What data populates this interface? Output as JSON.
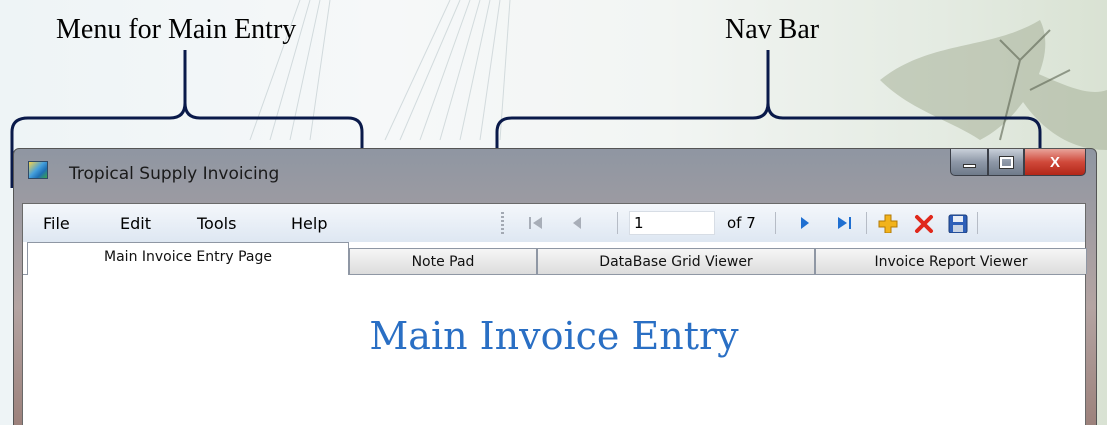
{
  "annotations": {
    "menu_label": "Menu for Main Entry",
    "nav_label": "Nav Bar"
  },
  "window": {
    "title": "Tropical Supply Invoicing",
    "caption_buttons": [
      "minimize-icon",
      "maximize-icon",
      "close-icon"
    ],
    "close_glyph": "X"
  },
  "menu": {
    "items": [
      "File",
      "Edit",
      "Tools",
      "Help"
    ]
  },
  "navbar": {
    "position": "1",
    "count": "of 7",
    "buttons": [
      "move-first-icon",
      "move-previous-icon",
      "move-next-icon",
      "move-last-icon",
      "add-new-icon",
      "delete-icon",
      "save-icon"
    ]
  },
  "tabs": {
    "items": [
      "Main Invoice Entry Page",
      "Note Pad",
      "DataBase Grid Viewer",
      "Invoice Report Viewer"
    ],
    "active_index": 0
  },
  "page": {
    "heading": "Main Invoice Entry"
  },
  "colors": {
    "heading": "#2a6fc4",
    "nav_arrow_active": "#1f6fd1",
    "nav_arrow_disabled": "#a8aeb8",
    "add_icon": "#f2b31b",
    "delete_icon": "#e0281b",
    "brace": "#0a1a4a"
  }
}
